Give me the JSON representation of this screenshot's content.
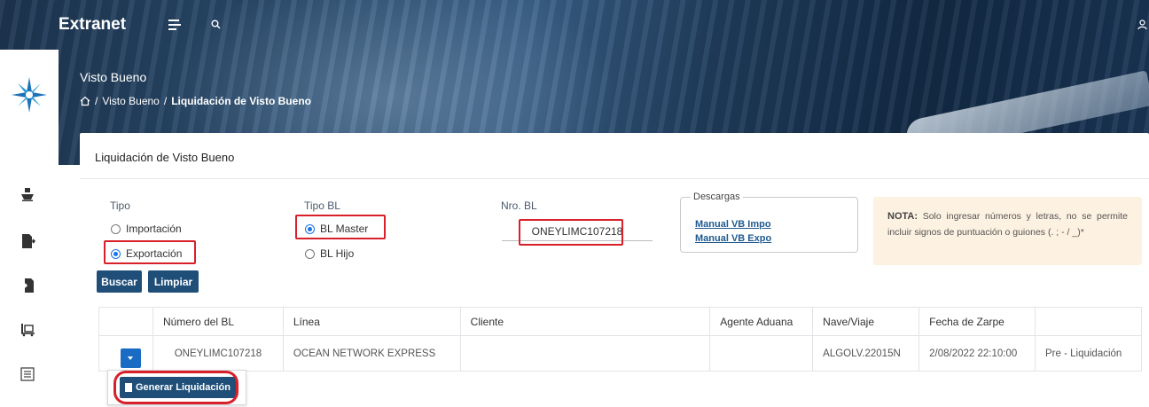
{
  "topbar": {
    "brand": "Extranet"
  },
  "page": {
    "heading": "Visto Bueno",
    "breadcrumb": {
      "level1": "Visto Bueno",
      "separator": "/",
      "current": "Liquidación de Visto Bueno"
    }
  },
  "card": {
    "title": "Liquidación de Visto Bueno",
    "tipo": {
      "label": "Tipo",
      "options": [
        "Importación",
        "Exportación"
      ],
      "selected": "Exportación"
    },
    "tipo_bl": {
      "label": "Tipo BL",
      "options": [
        "BL Master",
        "BL Hijo"
      ],
      "selected": "BL Master"
    },
    "nro_bl": {
      "label": "Nro. BL",
      "value": "ONEYLIMC107218"
    },
    "descargas": {
      "legend": "Descargas",
      "links": [
        "Manual VB Impo",
        "Manual VB Expo"
      ]
    },
    "nota": {
      "title": "NOTA:",
      "text": "Solo ingresar números y letras, no se permite incluir signos de puntuación o guiones (. ; - / _)*"
    },
    "buttons": {
      "search": "Buscar",
      "clear": "Limpiar"
    }
  },
  "table": {
    "headers": [
      "",
      "Número del BL",
      "Línea",
      "Cliente",
      "Agente Aduana",
      "Nave/Viaje",
      "Fecha de Zarpe",
      ""
    ],
    "rows": [
      {
        "bl": "ONEYLIMC107218",
        "linea": "OCEAN NETWORK EXPRESS",
        "cliente": "",
        "agente": "",
        "nave": "ALGOLV.22015N",
        "fecha": "2/08/2022 22:10:00",
        "estado": "Pre - Liquidación"
      }
    ]
  },
  "dropdown": {
    "generate_label": "Generar Liquidación"
  },
  "colors": {
    "primary": "#1f4f79",
    "highlight": "#d8202a",
    "radio": "#1a73e8",
    "nota_bg": "#fdf1e1"
  }
}
